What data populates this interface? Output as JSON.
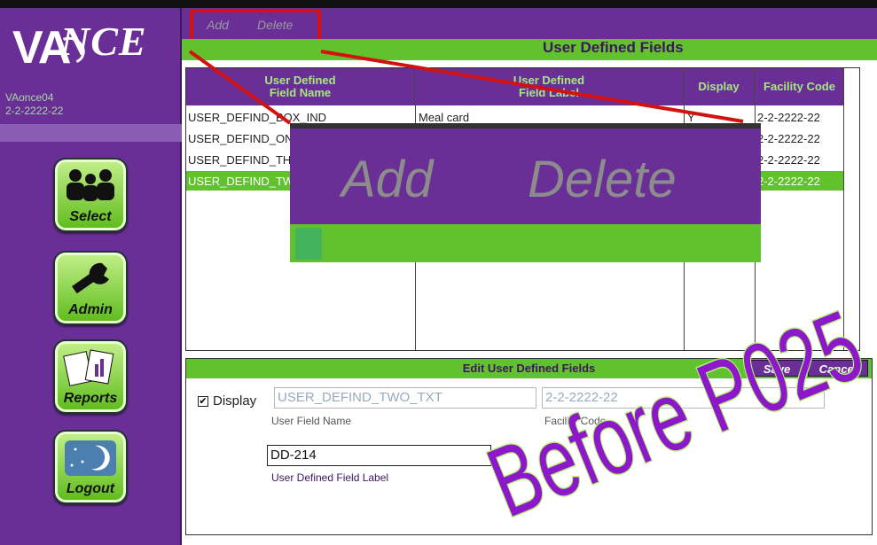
{
  "sidebar": {
    "logo_va": "VA",
    "logo_nce": "NCE",
    "user_name": "VAonce04",
    "user_code": "2-2-2222-22",
    "nav": [
      {
        "label": "Select",
        "icon": "people-icon"
      },
      {
        "label": "Admin",
        "icon": "wrench-icon"
      },
      {
        "label": "Reports",
        "icon": "reports-icon"
      },
      {
        "label": "Logout",
        "icon": "moon-icon"
      }
    ]
  },
  "menu": {
    "add": "Add",
    "delete": "Delete"
  },
  "page_title": "User Defined Fields",
  "table": {
    "headers": [
      "User Defined\nField Name",
      "User Defined\nField Label",
      "Display",
      "Facility Code"
    ],
    "rows": [
      {
        "name": "USER_DEFIND_BOX_IND",
        "label": "Meal card",
        "display": "Y",
        "facility": "2-2-2222-22",
        "selected": false
      },
      {
        "name": "USER_DEFIND_ON",
        "label": "",
        "display": "",
        "facility": "2-2-2222-22",
        "selected": false
      },
      {
        "name": "USER_DEFIND_TH",
        "label": "",
        "display": "",
        "facility": "2-2-2222-22",
        "selected": false
      },
      {
        "name": "USER_DEFIND_TW",
        "label": "",
        "display": "",
        "facility": "2-2-2222-22",
        "selected": true
      }
    ]
  },
  "zoom": {
    "add": "Add",
    "delete": "Delete"
  },
  "edit": {
    "title": "Edit User Defined Fields",
    "save": "Save",
    "cancel": "Cancel",
    "display_label": "Display",
    "display_checked": true,
    "field_name_value": "USER_DEFIND_TWO_TXT",
    "field_name_caption": "User Field Name",
    "facility_value": "2-2-2222-22",
    "facility_caption": "Facility Code",
    "field_label_value": "DD-214",
    "field_label_caption": "User Defined Field Label"
  },
  "watermark": "Before P025",
  "colors": {
    "purple": "#6a2f97",
    "green": "#62c22e",
    "red": "#d41111",
    "gray": "#8c8c8c"
  }
}
